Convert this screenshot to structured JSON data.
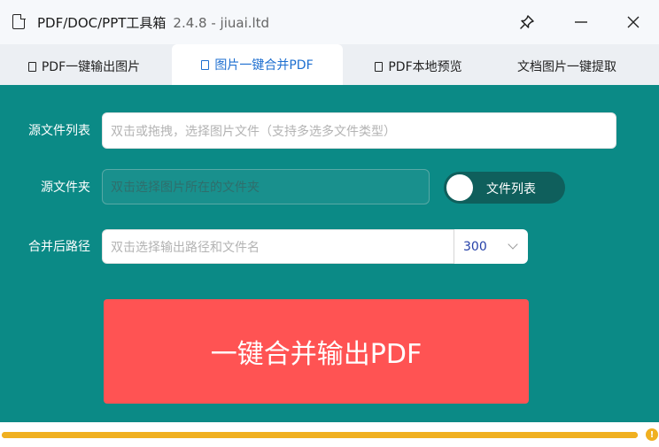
{
  "app": {
    "title": "PDF/DOC/PPT工具箱",
    "version": "2.4.8 - jiuai.ltd"
  },
  "titlebar": {
    "pin_icon": "pin-icon",
    "minimize_icon": "minimize-icon",
    "close_icon": "close-icon"
  },
  "tabs": [
    {
      "label": "PDF一键输出图片",
      "icon": "pdf-file-icon"
    },
    {
      "label": "图片一键合并PDF",
      "icon": "pdf-file-icon",
      "active": true
    },
    {
      "label": "PDF本地预览",
      "icon": "pdf-file-icon"
    },
    {
      "label": "文档图片一键提取"
    }
  ],
  "form": {
    "file_list_label": "源文件列表",
    "file_list_placeholder": "双击或拖拽，选择图片文件（支持多选多文件类型）",
    "folder_label": "源文件夹",
    "folder_placeholder": "双击选择图片所在的文件夹",
    "toggle_label": "文件列表",
    "output_label": "合并后路径",
    "output_placeholder": "双击选择输出路径和文件名",
    "dpi_value": "300"
  },
  "action": {
    "merge_label": "一键合并输出PDF"
  },
  "progress": {
    "value": 1.0,
    "info_icon": "info-icon"
  },
  "colors": {
    "main_bg": "#0b8a86",
    "accent_button": "#ff5353",
    "active_tab_text": "#1e6fd0",
    "progress": "#f0b020"
  }
}
